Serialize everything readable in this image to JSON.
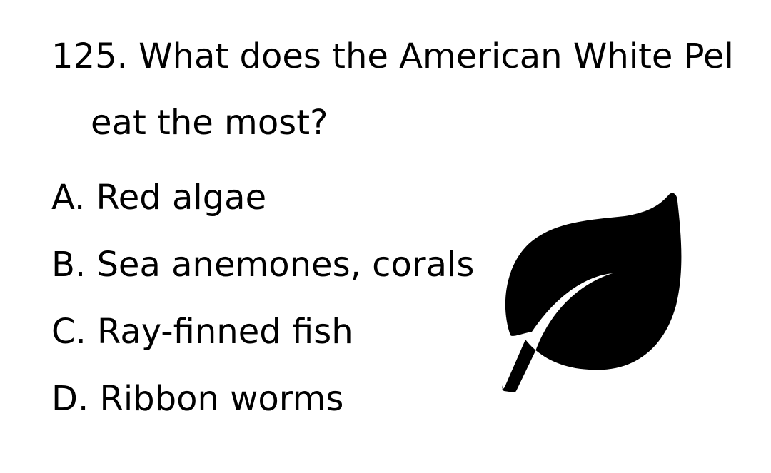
{
  "question": {
    "line1": "125. What does the American White Pel",
    "line2": "eat the most?"
  },
  "options": [
    {
      "label": "A. Red algae"
    },
    {
      "label": "B. Sea anemones, corals"
    },
    {
      "label": "C. Ray-finned fish"
    },
    {
      "label": "D. Ribbon worms"
    }
  ],
  "illustration": {
    "icon": "leaf-icon",
    "color": "#000000"
  }
}
